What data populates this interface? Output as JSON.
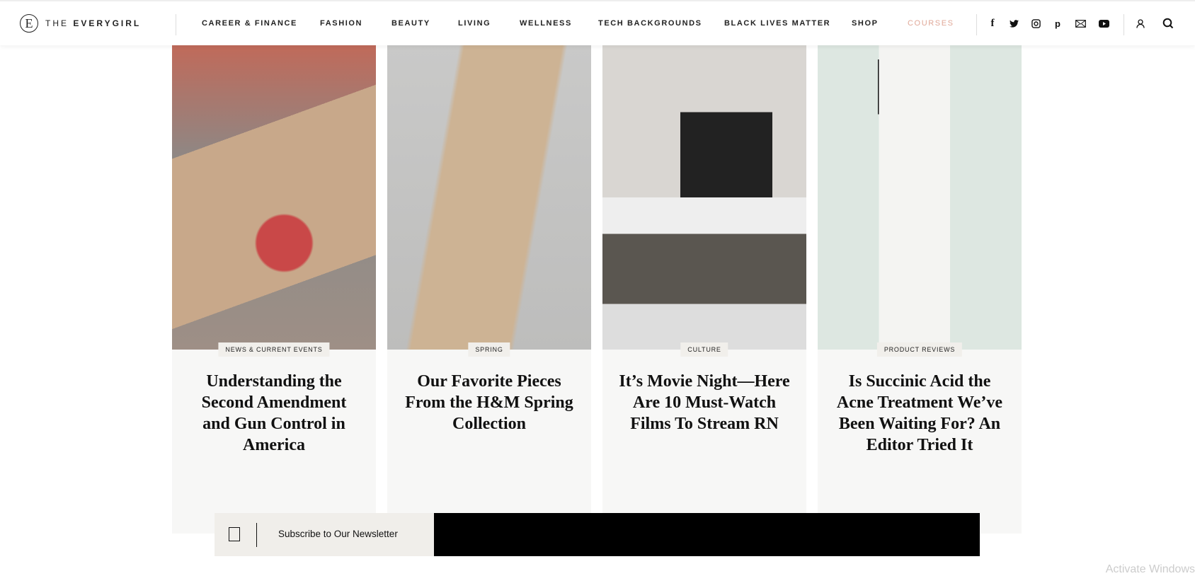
{
  "header": {
    "logo": {
      "prefix": "THE",
      "name": "EVERYGIRL",
      "mark": "E"
    },
    "nav": [
      "CAREER & FINANCE",
      "FASHION",
      "BEAUTY",
      "LIVING",
      "WELLNESS",
      "TECH BACKGROUNDS",
      "BLACK LIVES MATTER",
      "SHOP",
      "COURSES"
    ],
    "accent": "#e0a898",
    "social_icons": [
      "facebook-icon",
      "twitter-icon",
      "instagram-icon",
      "pinterest-icon",
      "mail-icon",
      "youtube-icon"
    ],
    "utility_icons": [
      "user-icon",
      "search-icon"
    ]
  },
  "cards": [
    {
      "category": "NEWS & CURRENT EVENTS",
      "title": "Understanding the Second Amendment and Gun Control in America"
    },
    {
      "category": "SPRING",
      "title": "Our Favorite Pieces From the H&M Spring Collection"
    },
    {
      "category": "CULTURE",
      "title": "It’s Movie Night—Here Are 10 Must-Watch Films To Stream RN"
    },
    {
      "category": "PRODUCT REVIEWS",
      "title": "Is Succinic Acid the Acne Treatment We’ve Been Waiting For? An Editor Tried It"
    }
  ],
  "newsletter": {
    "label": "Subscribe to Our Newsletter"
  },
  "watermark": "Activate Windows"
}
